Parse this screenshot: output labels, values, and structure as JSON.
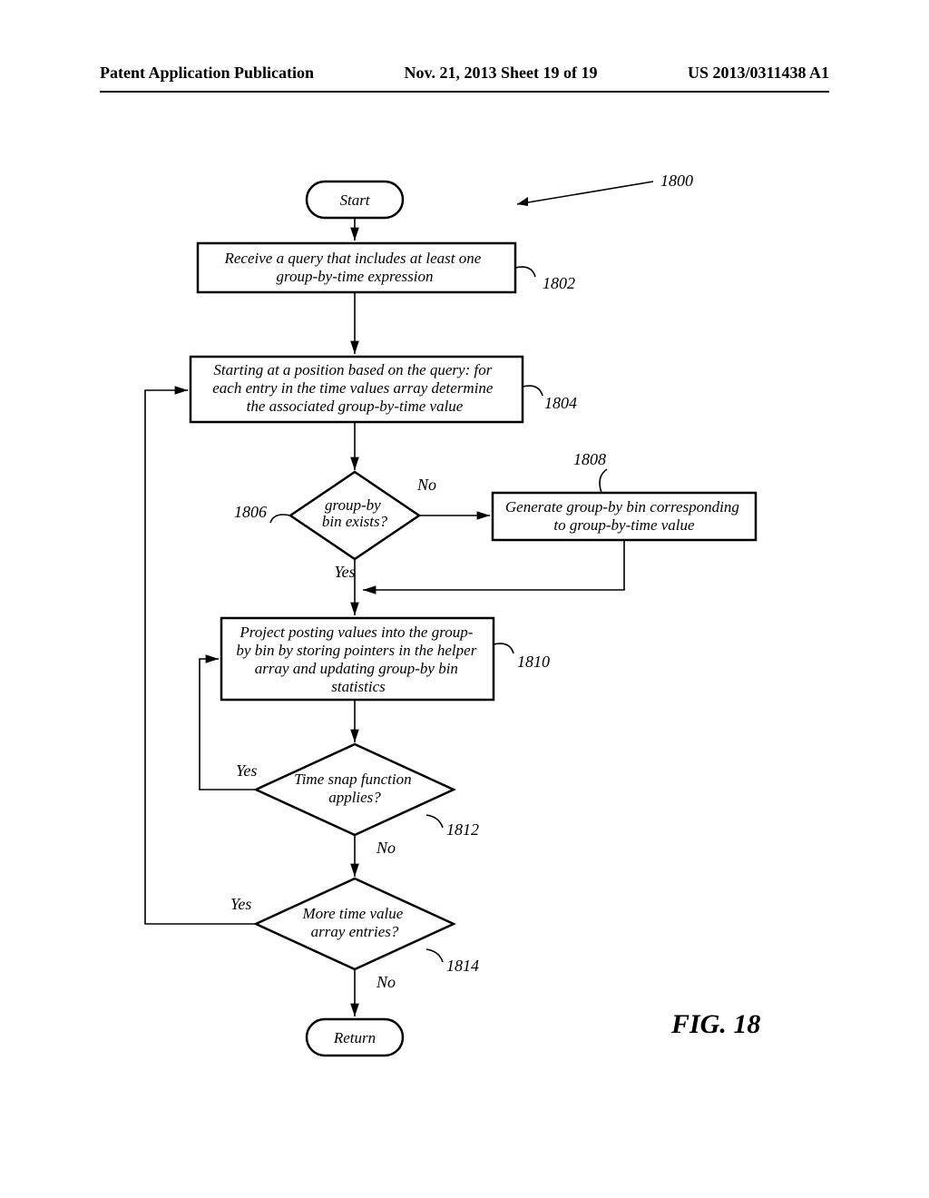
{
  "header": {
    "left": "Patent Application Publication",
    "center": "Nov. 21, 2013  Sheet 19 of 19",
    "right": "US 2013/0311438 A1"
  },
  "nodes": {
    "start": "Start",
    "step_1802": "Receive a query that includes at least one\ngroup-by-time expression",
    "step_1804": "Starting at a position based on the query: for\neach entry in the time values array determine\nthe associated group-by-time value",
    "dec_1806": "group-by\nbin exists?",
    "step_1808": "Generate group-by bin corresponding\nto group-by-time value",
    "step_1810": "Project posting values into the group-\nby bin by storing pointers in the helper\narray and updating group-by bin\nstatistics",
    "dec_1812": "Time snap function\napplies?",
    "dec_1814": "More time value\narray entries?",
    "return": "Return"
  },
  "edge_labels": {
    "no": "No",
    "yes": "Yes"
  },
  "refs": {
    "r1800": "1800",
    "r1802": "1802",
    "r1804": "1804",
    "r1806": "1806",
    "r1808": "1808",
    "r1810": "1810",
    "r1812": "1812",
    "r1814": "1814"
  },
  "figure_label": "FIG. 18",
  "chart_data": {
    "type": "flowchart",
    "title": "FIG. 18",
    "ref": "1800",
    "nodes": [
      {
        "id": "start",
        "shape": "terminator",
        "label": "Start"
      },
      {
        "id": "n1802",
        "shape": "process",
        "label": "Receive a query that includes at least one group-by-time expression",
        "ref": "1802"
      },
      {
        "id": "n1804",
        "shape": "process",
        "label": "Starting at a position based on the query: for each entry in the time values array determine the associated group-by-time value",
        "ref": "1804"
      },
      {
        "id": "n1806",
        "shape": "decision",
        "label": "group-by bin exists?",
        "ref": "1806"
      },
      {
        "id": "n1808",
        "shape": "process",
        "label": "Generate group-by bin corresponding to group-by-time value",
        "ref": "1808"
      },
      {
        "id": "n1810",
        "shape": "process",
        "label": "Project posting values into the group-by bin by storing pointers in the helper array and updating group-by bin statistics",
        "ref": "1810"
      },
      {
        "id": "n1812",
        "shape": "decision",
        "label": "Time snap function applies?",
        "ref": "1812"
      },
      {
        "id": "n1814",
        "shape": "decision",
        "label": "More time value array entries?",
        "ref": "1814"
      },
      {
        "id": "return",
        "shape": "terminator",
        "label": "Return"
      }
    ],
    "edges": [
      {
        "from": "start",
        "to": "n1802"
      },
      {
        "from": "n1802",
        "to": "n1804"
      },
      {
        "from": "n1804",
        "to": "n1806"
      },
      {
        "from": "n1806",
        "to": "n1808",
        "label": "No"
      },
      {
        "from": "n1806",
        "to": "n1810",
        "label": "Yes"
      },
      {
        "from": "n1808",
        "to": "n1810"
      },
      {
        "from": "n1810",
        "to": "n1812"
      },
      {
        "from": "n1812",
        "to": "n1810",
        "label": "Yes"
      },
      {
        "from": "n1812",
        "to": "n1814",
        "label": "No"
      },
      {
        "from": "n1814",
        "to": "n1804",
        "label": "Yes"
      },
      {
        "from": "n1814",
        "to": "return",
        "label": "No"
      }
    ]
  }
}
